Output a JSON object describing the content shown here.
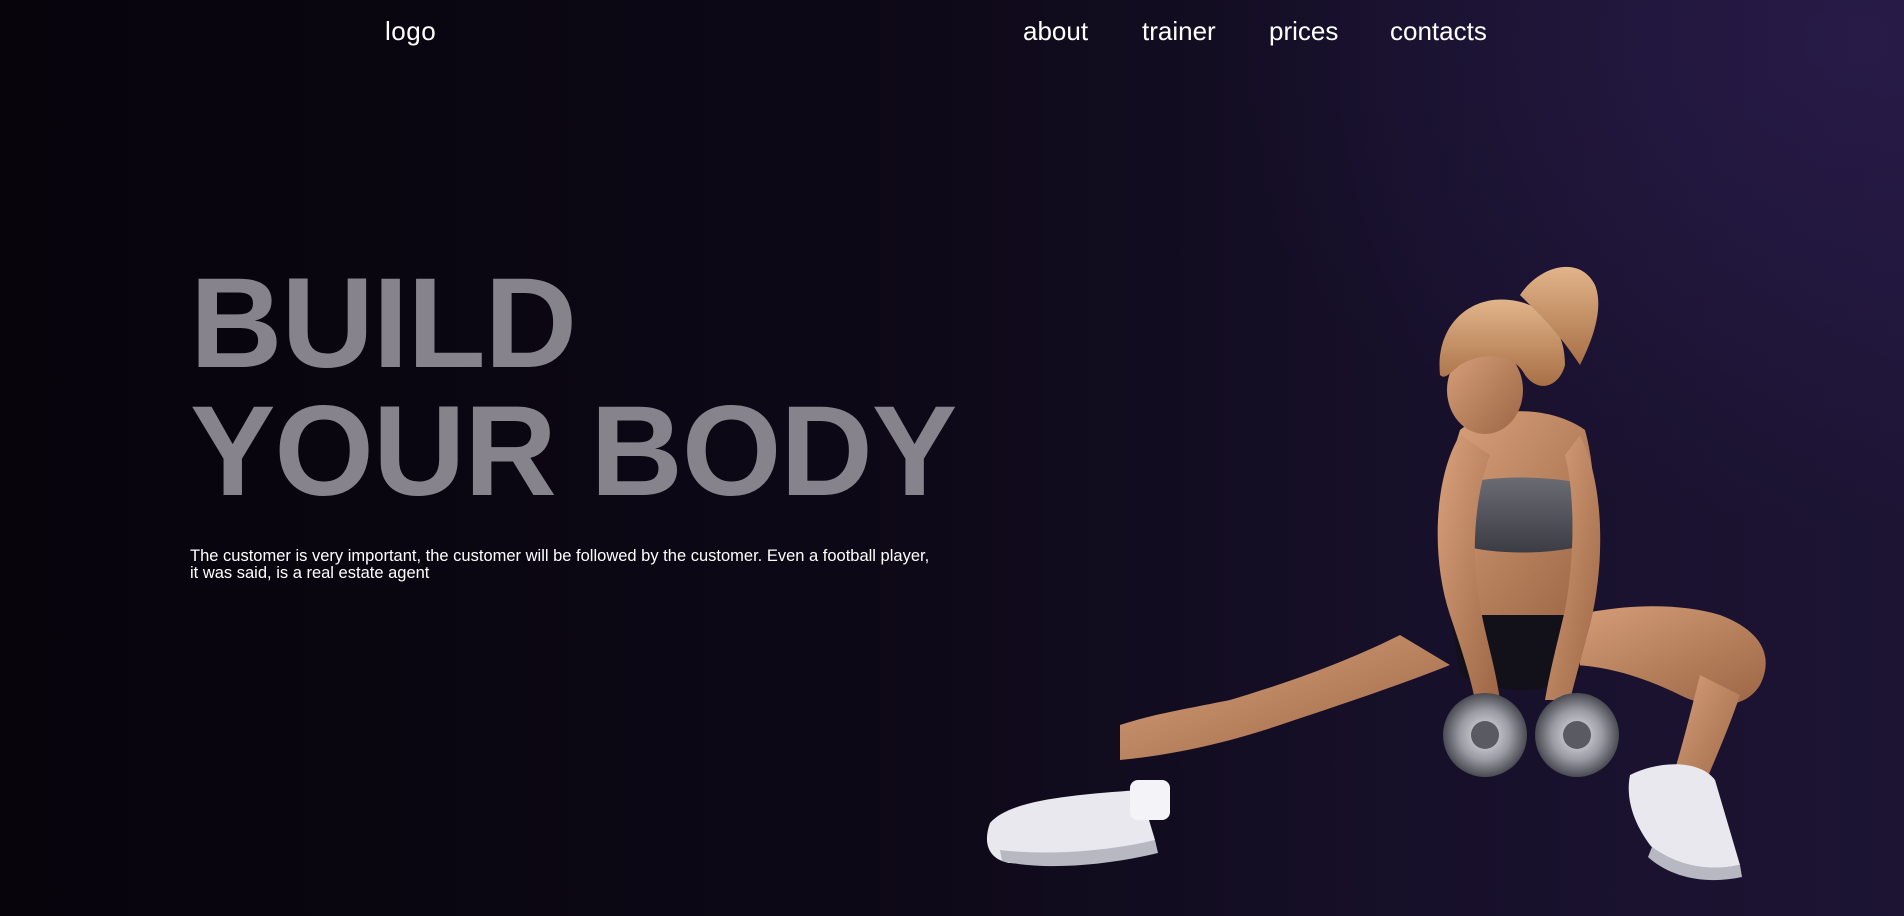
{
  "header": {
    "logo": "logo",
    "nav": [
      "about",
      "trainer",
      "prices",
      "contacts"
    ]
  },
  "hero": {
    "title_line1": "BUILD",
    "title_line2": "YOUR BODY",
    "description": "The customer is very important, the customer will be followed by the customer. Even a football player, it was said, is a real estate agent"
  },
  "colors": {
    "background": "#0d0816",
    "title": "#86838c",
    "text": "#ffffff"
  }
}
